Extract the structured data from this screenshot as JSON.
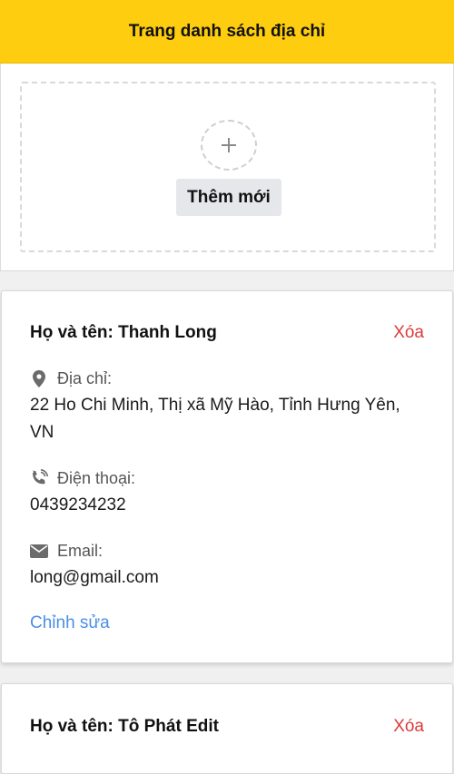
{
  "header": {
    "title": "Trang danh sách địa chỉ"
  },
  "add": {
    "label": "Thêm mới"
  },
  "labels": {
    "name_prefix": "Họ và tên:",
    "delete": "Xóa",
    "address": "Địa chỉ:",
    "phone": "Điện thoại:",
    "email": "Email:",
    "edit": "Chỉnh sửa"
  },
  "addresses": [
    {
      "name": "Họ và tên: Thanh Long",
      "address": "22 Ho Chi Minh, Thị xã Mỹ Hào, Tỉnh Hưng Yên, VN",
      "phone": "0439234232",
      "email": "long@gmail.com"
    },
    {
      "name": "Họ và tên: Tô Phát Edit"
    }
  ],
  "colors": {
    "header_bg": "#fecd0f",
    "delete": "#dc3c3c",
    "edit_link": "#4a8fe8"
  },
  "icons": {
    "add": "plus-icon",
    "address": "map-marker-icon",
    "phone": "phone-volume-icon",
    "email": "envelope-icon"
  }
}
